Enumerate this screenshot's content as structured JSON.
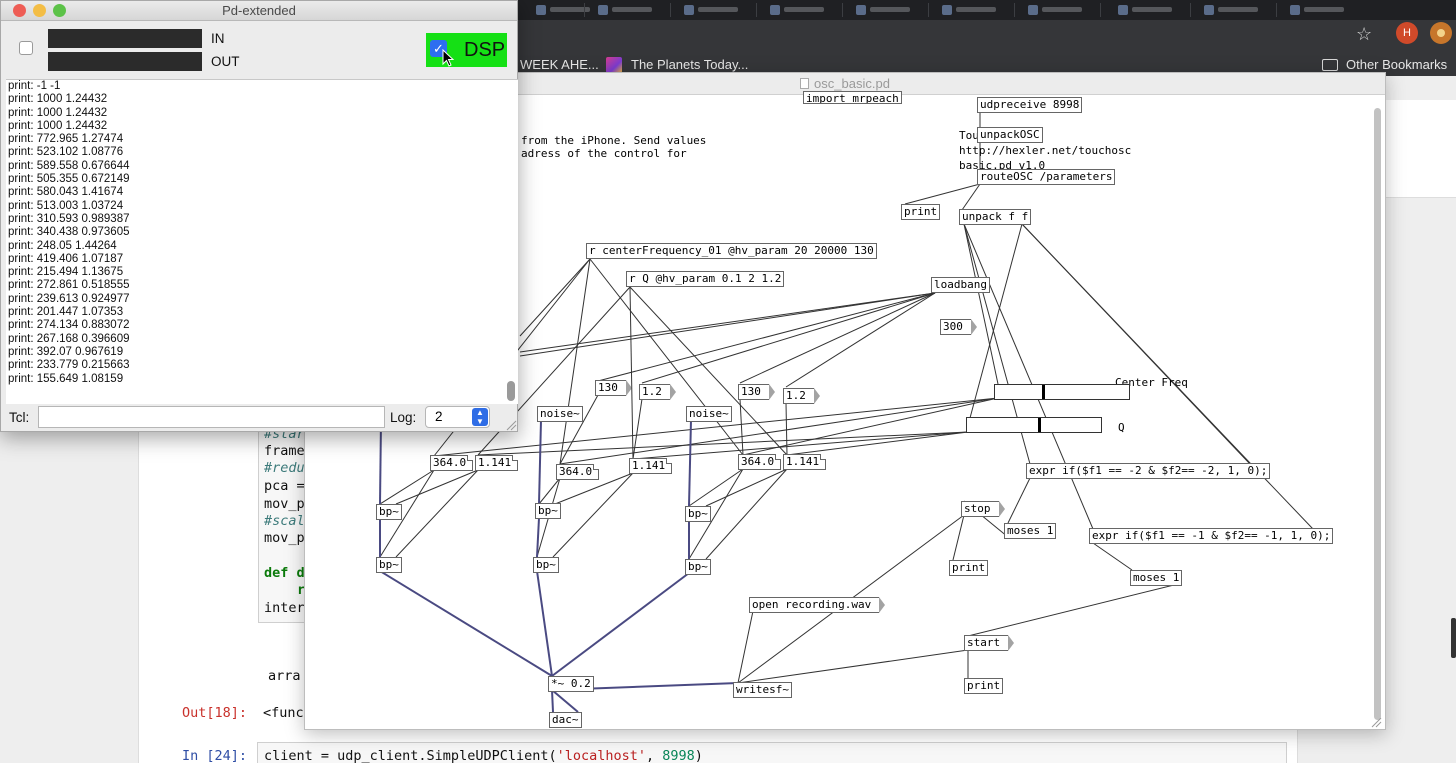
{
  "browser": {
    "bookmarks": {
      "week": "WEEK AHE...",
      "planets": "The Planets Today...",
      "other": "Other Bookmarks"
    },
    "profile_initial": "H"
  },
  "notebook": {
    "code_lines": [
      "#star",
      "frame",
      "#redu",
      "pca =",
      "mov_p",
      "#scal",
      "mov_p",
      "def d",
      "r",
      "inter"
    ],
    "array_text": "arra",
    "out_prompt": "Out[18]:",
    "out_text": "<func",
    "in_prompt": "In [24]:",
    "in_code_a": "client = udp_client.SimpleUDPClient(",
    "in_code_str": "'localhost'",
    "in_code_b": ", ",
    "in_code_num": "8998",
    "in_code_c": ")"
  },
  "patch": {
    "title": "osc_basic.pd",
    "comments": {
      "line1": "from the iPhone. Send values",
      "line2": "adress of the control for",
      "touch": "Tou",
      "url": "http://hexler.net/touchosc",
      "basic": "basic.pd v1.0",
      "center_freq": "Center Freq",
      "q": "Q"
    },
    "objects": {
      "import": "import mrpeach",
      "udpreceive": "udpreceive 8998",
      "unpackosc": "unpackOSC",
      "routeosc": "routeOSC /parameters",
      "print1": "print",
      "unpack": "unpack f f",
      "center_param": "r centerFrequency_01 @hv_param 20 20000 130",
      "q_param": "r Q @hv_param 0.1 2 1.2",
      "loadbang": "loadbang",
      "noise1": "noise~",
      "noise2": "noise~",
      "bp1a": "bp~",
      "bp1b": "bp~",
      "bp2a": "bp~",
      "bp2b": "bp~",
      "bp3a": "bp~",
      "bp3b": "bp~",
      "expr1": "expr if($f1 == -2 & $f2== -2, 1, 0);",
      "expr2": "expr if($f1 == -1 & $f2== -1, 1, 0);",
      "moses1": "moses 1",
      "moses2": "moses 1",
      "print2": "print",
      "print3": "print",
      "writesf": "writesf~",
      "mul": "*~ 0.2",
      "dac": "dac~"
    },
    "messages": {
      "m300": "300",
      "m130a": "130",
      "m12a": "1.2",
      "m130b": "130",
      "m12b": "1.2",
      "stop": "stop",
      "open": "open recording.wav",
      "start": "start"
    },
    "numbers": {
      "n1": "364.0",
      "n2": "1.141",
      "n3": "364.0",
      "n4": "1.141",
      "n5": "364.0",
      "n6": "1.141"
    },
    "sliders": {
      "center_freq_level": 0.36,
      "q_level": 0.54
    }
  },
  "pd_window": {
    "title": "Pd-extended",
    "in_label": "IN",
    "out_label": "OUT",
    "dsp_label": "DSP",
    "dsp_on": true,
    "console_lines": [
      "print: -1 -1",
      "print: 1000 1.24432",
      "print: 1000 1.24432",
      "print: 1000 1.24432",
      "print: 772.965 1.27474",
      "print: 523.102 1.08776",
      "print: 589.558 0.676644",
      "print: 505.355 0.672149",
      "print: 580.043 1.41674",
      "print: 513.003 1.03724",
      "print: 310.593 0.989387",
      "print: 340.438 0.973605",
      "print: 248.05 1.44264",
      "print: 419.406 1.07187",
      "print: 215.494 1.13675",
      "print: 272.861 0.518555",
      "print: 239.613 0.924977",
      "print: 201.447 1.07353",
      "print: 274.134 0.883072",
      "print: 267.168 0.396609",
      "print: 392.07 0.967619",
      "print: 233.779 0.215663",
      "print: 155.649 1.08159"
    ],
    "tcl_label": "Tcl:",
    "tcl_value": "",
    "log_label": "Log:",
    "log_value": "2"
  }
}
